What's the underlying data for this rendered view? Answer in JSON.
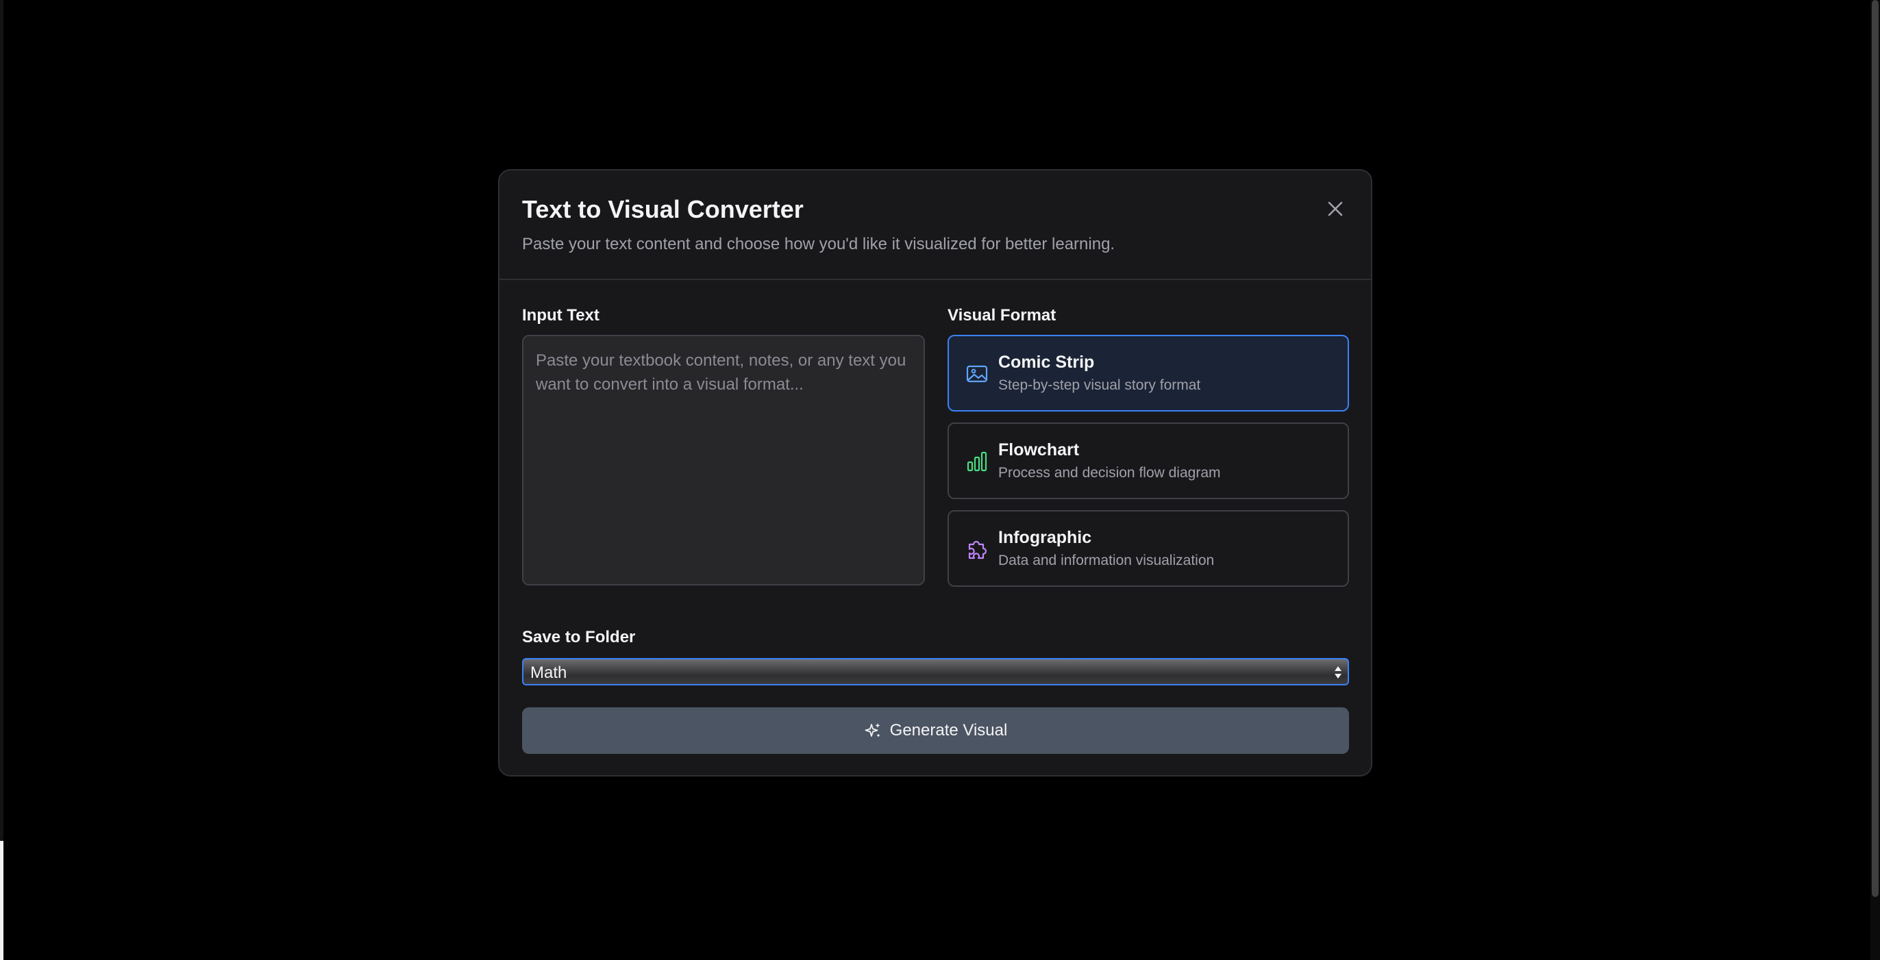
{
  "modal": {
    "title": "Text to Visual Converter",
    "subtitle": "Paste your text content and choose how you'd like it visualized for better learning."
  },
  "input": {
    "label": "Input Text",
    "placeholder": "Paste your textbook content, notes, or any text you want to convert into a visual format...",
    "value": ""
  },
  "visual_format": {
    "label": "Visual Format",
    "selected": "Comic Strip",
    "options": [
      {
        "name": "Comic Strip",
        "description": "Step-by-step visual story format",
        "icon": "image-icon",
        "color": "#60a5fa"
      },
      {
        "name": "Flowchart",
        "description": "Process and decision flow diagram",
        "icon": "bar-chart-icon",
        "color": "#4ade80"
      },
      {
        "name": "Infographic",
        "description": "Data and information visualization",
        "icon": "puzzle-icon",
        "color": "#c084fc"
      }
    ]
  },
  "folder": {
    "label": "Save to Folder",
    "selected": "Math"
  },
  "actions": {
    "generate_label": "Generate Visual",
    "generate_icon": "sparkles-icon",
    "close_icon": "close-icon"
  },
  "colors": {
    "accent": "#3b82f6",
    "modal_bg": "#18181b",
    "button_bg": "#4b5563"
  }
}
